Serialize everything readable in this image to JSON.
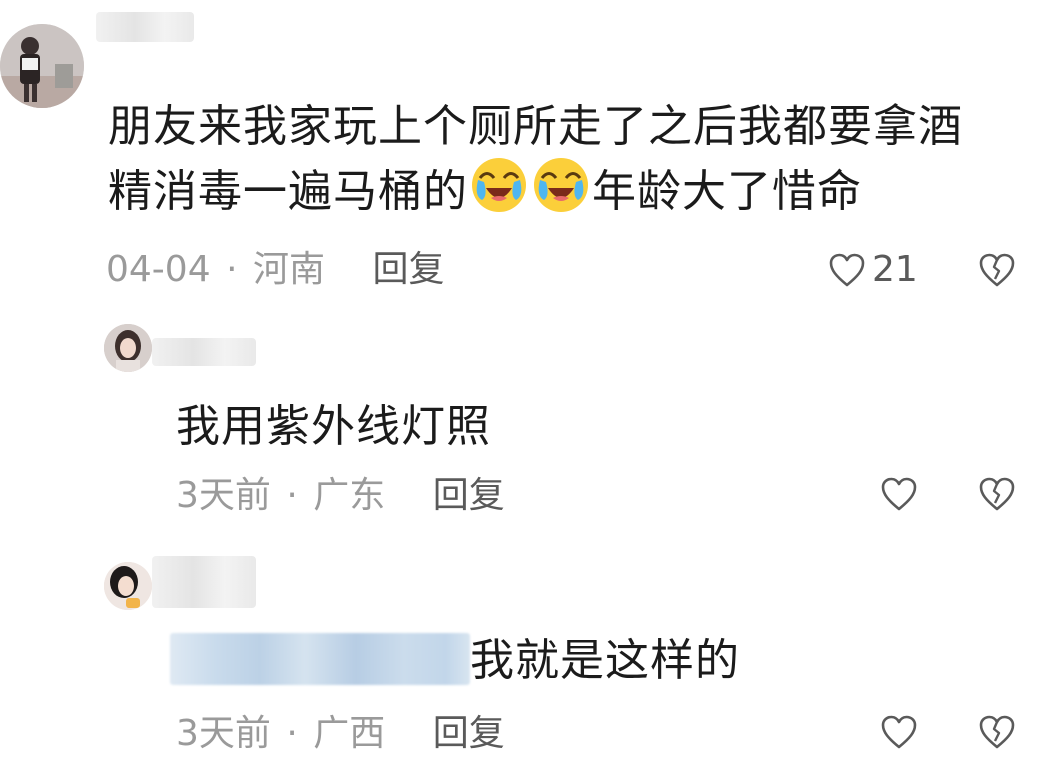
{
  "colors": {
    "meta": "#9a9a9a",
    "action": "#5a5a5a",
    "text": "#1b1b1b",
    "mention_blur": "#c9dbec"
  },
  "comments": [
    {
      "text_line1": "朋友来我家玩上个厕所走了之后我都要拿酒",
      "text_line2_pre": "精消毒一遍马桶的",
      "emojis": [
        "laugh-cry-emoji",
        "laugh-cry-emoji"
      ],
      "text_line2_post": "年龄大了惜命",
      "time": "04-04",
      "dot": "·",
      "location": "河南",
      "reply_label": "回复",
      "like_count": "21"
    },
    {
      "text": "我用紫外线灯照",
      "time": "3天前",
      "dot": "·",
      "location": "广东",
      "reply_label": "回复"
    },
    {
      "text": "我就是这样的",
      "time": "3天前",
      "dot": "·",
      "location": "广西",
      "reply_label": "回复"
    }
  ]
}
